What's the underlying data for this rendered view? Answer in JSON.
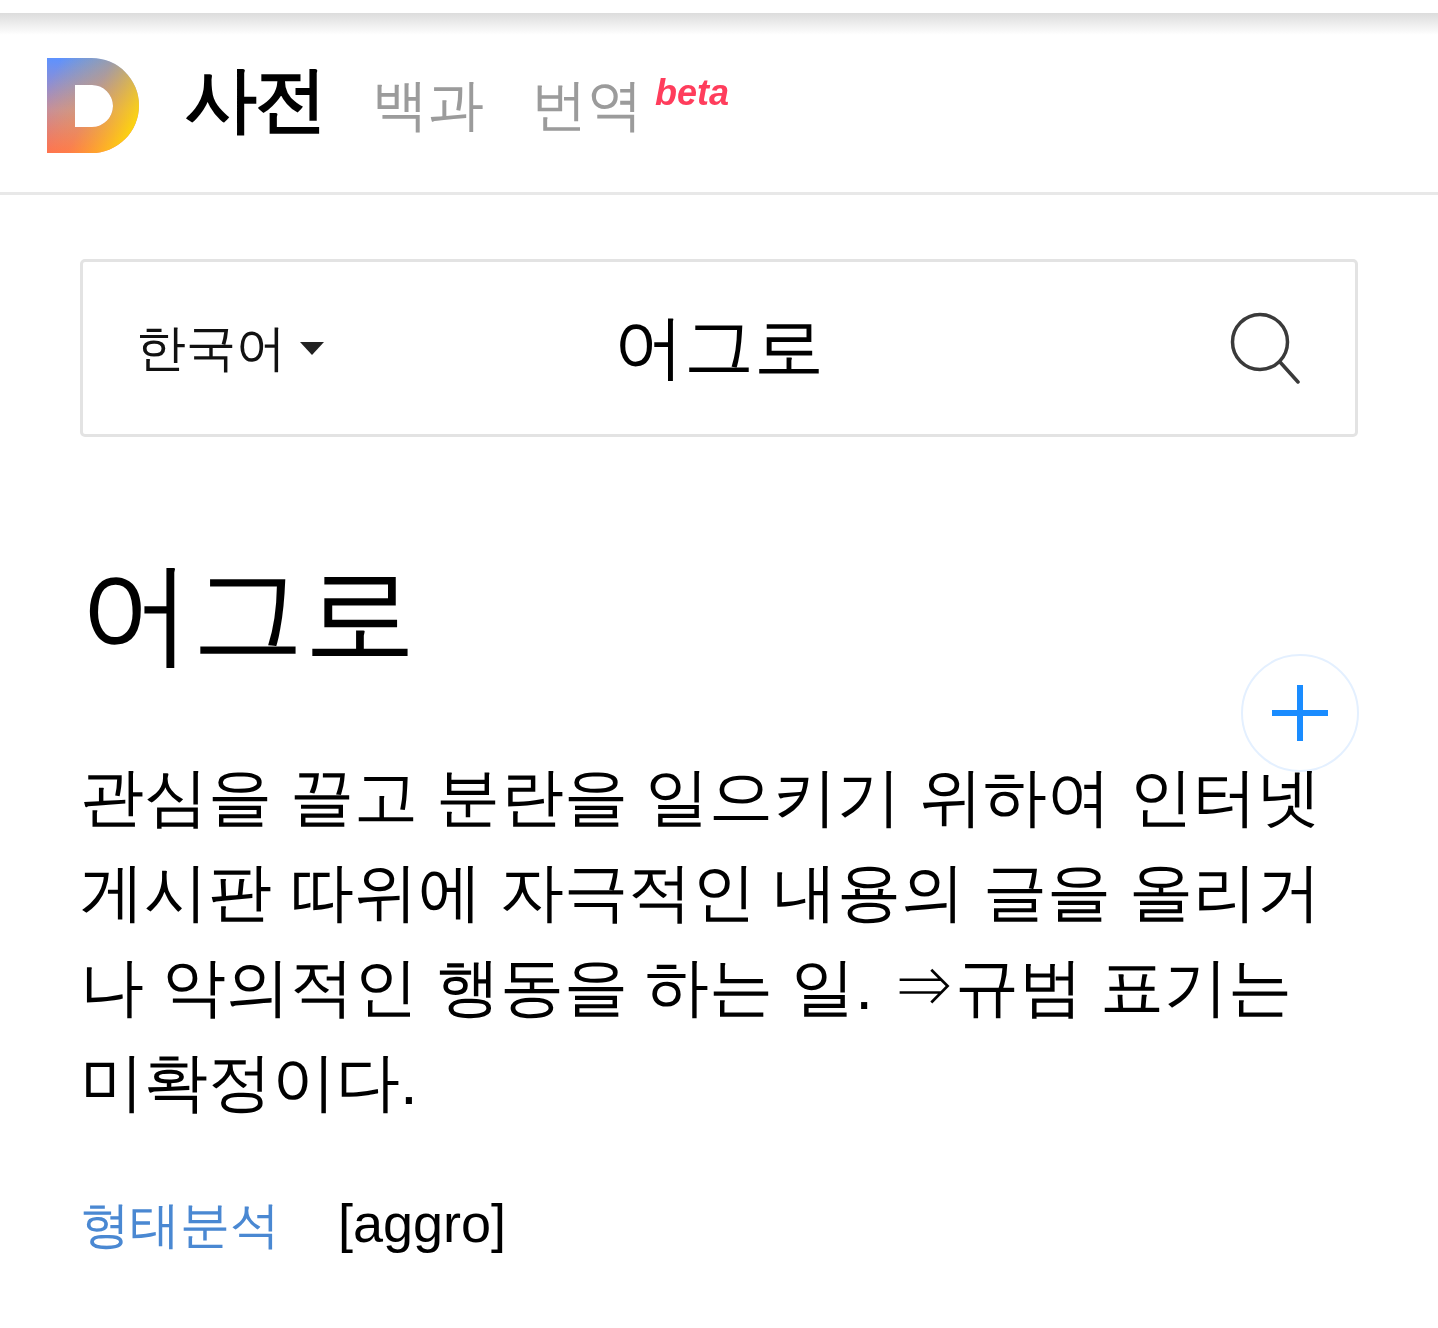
{
  "header": {
    "tabs": [
      {
        "label": "사전",
        "selected": true
      },
      {
        "label": "백과",
        "selected": false
      },
      {
        "label": "번역",
        "selected": false,
        "badge": "beta"
      }
    ]
  },
  "search": {
    "language": "한국어",
    "value": "어그로"
  },
  "entry": {
    "headword": "어그로",
    "definition": "관심을 끌고 분란을 일으키기 위하여 인터넷 게시판 따위에 자극적인 내용의 글을 올리거나 악의적인 행동을 하는 일. ⇒규범 표기는 미확정이다.",
    "morphology_link": "형태분석",
    "origin": "[aggro]"
  }
}
